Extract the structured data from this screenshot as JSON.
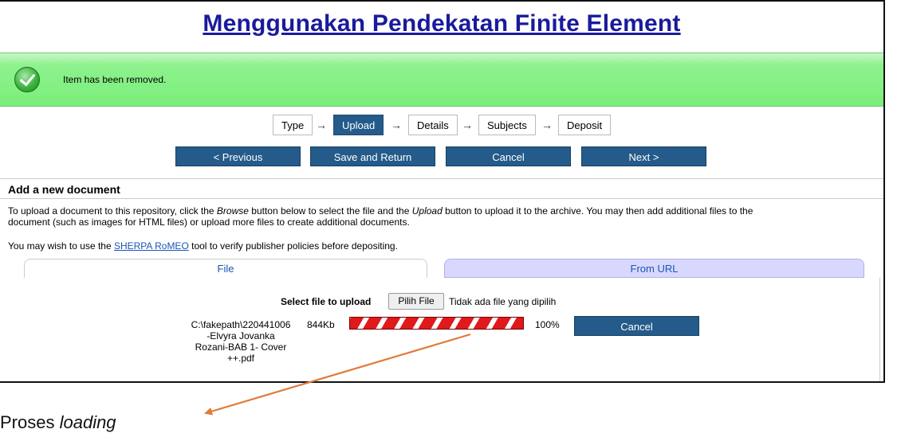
{
  "page_title": "Menggunakan Pendekatan Finite Element",
  "message": "Item has been removed.",
  "workflow": {
    "stages": [
      "Type",
      "Upload",
      "Details",
      "Subjects",
      "Deposit"
    ],
    "active": "Upload"
  },
  "nav": {
    "previous": "< Previous",
    "save_return": "Save and Return",
    "cancel": "Cancel",
    "next": "Next >"
  },
  "section_title": "Add a new document",
  "intro": {
    "line1_a": "To upload a document to this repository, click the ",
    "browse": "Browse",
    "line1_b": " button below to select the file and the ",
    "upload": "Upload",
    "line1_c": " button to upload it to the archive. You may then add additional files to the",
    "line2": "document (such as images for HTML files) or upload more files to create additional documents."
  },
  "sherpa": {
    "before": "You may wish to use the ",
    "link": "SHERPA RoMEO",
    "after": " tool to verify publisher policies before depositing."
  },
  "tabs": {
    "file": "File",
    "url": "From URL"
  },
  "upload": {
    "select_label": "Select file to upload",
    "choose_button": "Pilih File",
    "no_file": "Tidak ada file yang dipilih",
    "file_path_lines": [
      "C:\\fakepath\\220441006",
      "-Elvyra Jovanka",
      "Rozani-BAB 1- Cover",
      "++.pdf"
    ],
    "file_size": "844Kb",
    "progress_percent": 100,
    "progress_label": "100%",
    "cancel_label": "Cancel"
  },
  "annotation": {
    "text": "Proses ",
    "emph": "loading"
  },
  "colors": {
    "accent": "#245b8a",
    "progress": "#e0191b",
    "message_bg": "#7aee7a",
    "arrow": "#e07a3a"
  }
}
